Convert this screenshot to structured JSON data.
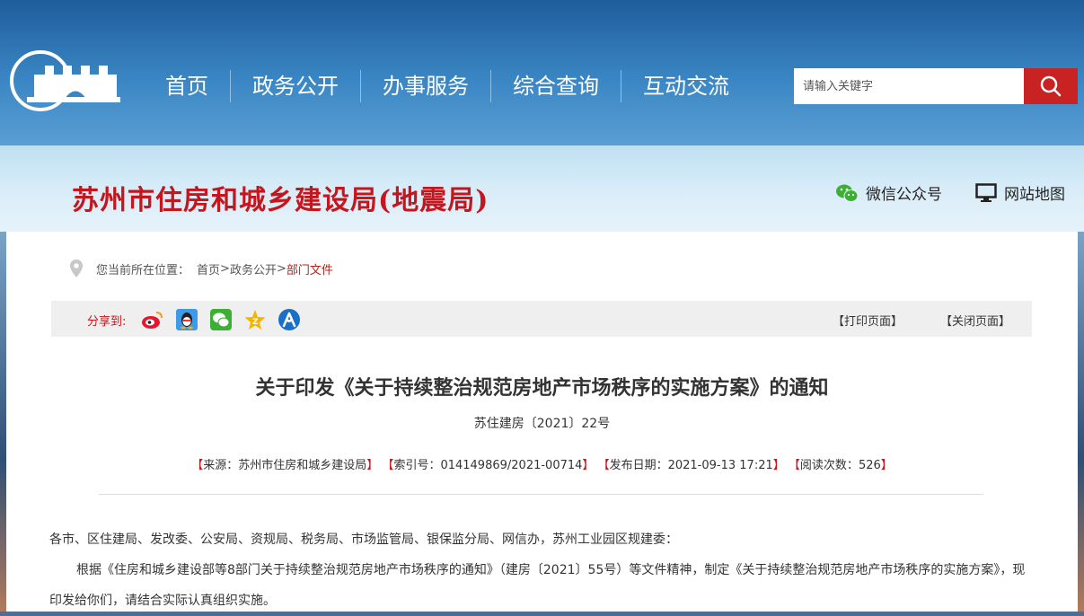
{
  "header": {
    "nav": [
      "首页",
      "政务公开",
      "办事服务",
      "综合查询",
      "互动交流"
    ],
    "search_placeholder": "请输入关键字",
    "icons": {
      "logo": "city-wall-logo-icon",
      "search": "search-icon"
    },
    "colors": {
      "search_button": "#c92222",
      "header_bg": "#2f74b5"
    }
  },
  "banner": {
    "site_title": "苏州市住房和城乡建设局(地震局)",
    "wechat_label": "微信公众号",
    "sitemap_label": "网站地图",
    "colors": {
      "site_title": "#c4161c"
    }
  },
  "breadcrumb": {
    "prefix": "您当前所在位置：",
    "items": [
      "首页",
      "政务公开",
      "部门文件"
    ],
    "separator": ">"
  },
  "share": {
    "label": "分享到:",
    "icons": [
      "weibo-icon",
      "qq-icon",
      "wechat-icon",
      "qzone-icon",
      "renren-icon"
    ],
    "print": "【打印页面】",
    "close": "【关闭页面】"
  },
  "article": {
    "title": "关于印发《关于持续整治规范房地产市场秩序的实施方案》的通知",
    "doc_number": "苏住建房〔2021〕22号",
    "meta": {
      "source_label": "来源：",
      "source": "苏州市住房和城乡建设局",
      "index_label": "索引号：",
      "index": "014149869/2021-00714",
      "date_label": "发布日期：",
      "date": "2021-09-13 17:21",
      "views_label": "阅读次数：",
      "views": "526"
    },
    "salutation": "各市、区住建局、发改委、公安局、资规局、税务局、市场监管局、银保监分局、网信办，苏州工业园区规建委：",
    "paragraph1": "根据《住房和城乡建设部等8部门关于持续整治规范房地产市场秩序的通知》（建房〔2021〕55号）等文件精神，制定《关于持续整治规范房地产市场秩序的实施方案》，现印发给你们，请结合实际认真组织实施。"
  }
}
